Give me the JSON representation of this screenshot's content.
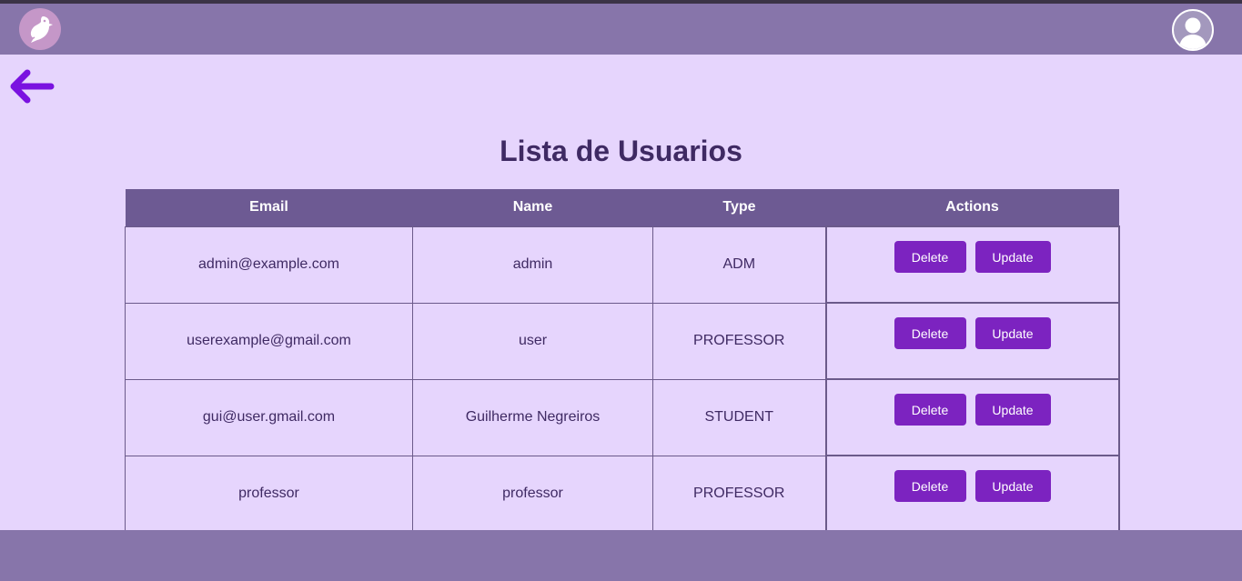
{
  "header": {
    "logo_icon": "bird-logo-icon",
    "profile_icon": "user-avatar-icon"
  },
  "nav": {
    "back_icon": "arrow-left-icon"
  },
  "page": {
    "title": "Lista de Usuarios"
  },
  "table": {
    "columns": [
      "Email",
      "Name",
      "Type",
      "Actions"
    ],
    "rows": [
      {
        "email": "admin@example.com",
        "name": "admin",
        "type": "ADM",
        "delete_label": "Delete",
        "update_label": "Update"
      },
      {
        "email": "userexample@gmail.com",
        "name": "user",
        "type": "PROFESSOR",
        "delete_label": "Delete",
        "update_label": "Update"
      },
      {
        "email": "gui@user.gmail.com",
        "name": "Guilherme Negreiros",
        "type": "STUDENT",
        "delete_label": "Delete",
        "update_label": "Update"
      },
      {
        "email": "professor",
        "name": "professor",
        "type": "PROFESSOR",
        "delete_label": "Delete",
        "update_label": "Update"
      }
    ]
  },
  "colors": {
    "header_bg": "#8775aa",
    "page_bg": "#e6d5fd",
    "table_header_bg": "#6d5a93",
    "button_bg": "#7c23c0",
    "arrow": "#7a12e0",
    "title_text": "#3f2a63"
  }
}
